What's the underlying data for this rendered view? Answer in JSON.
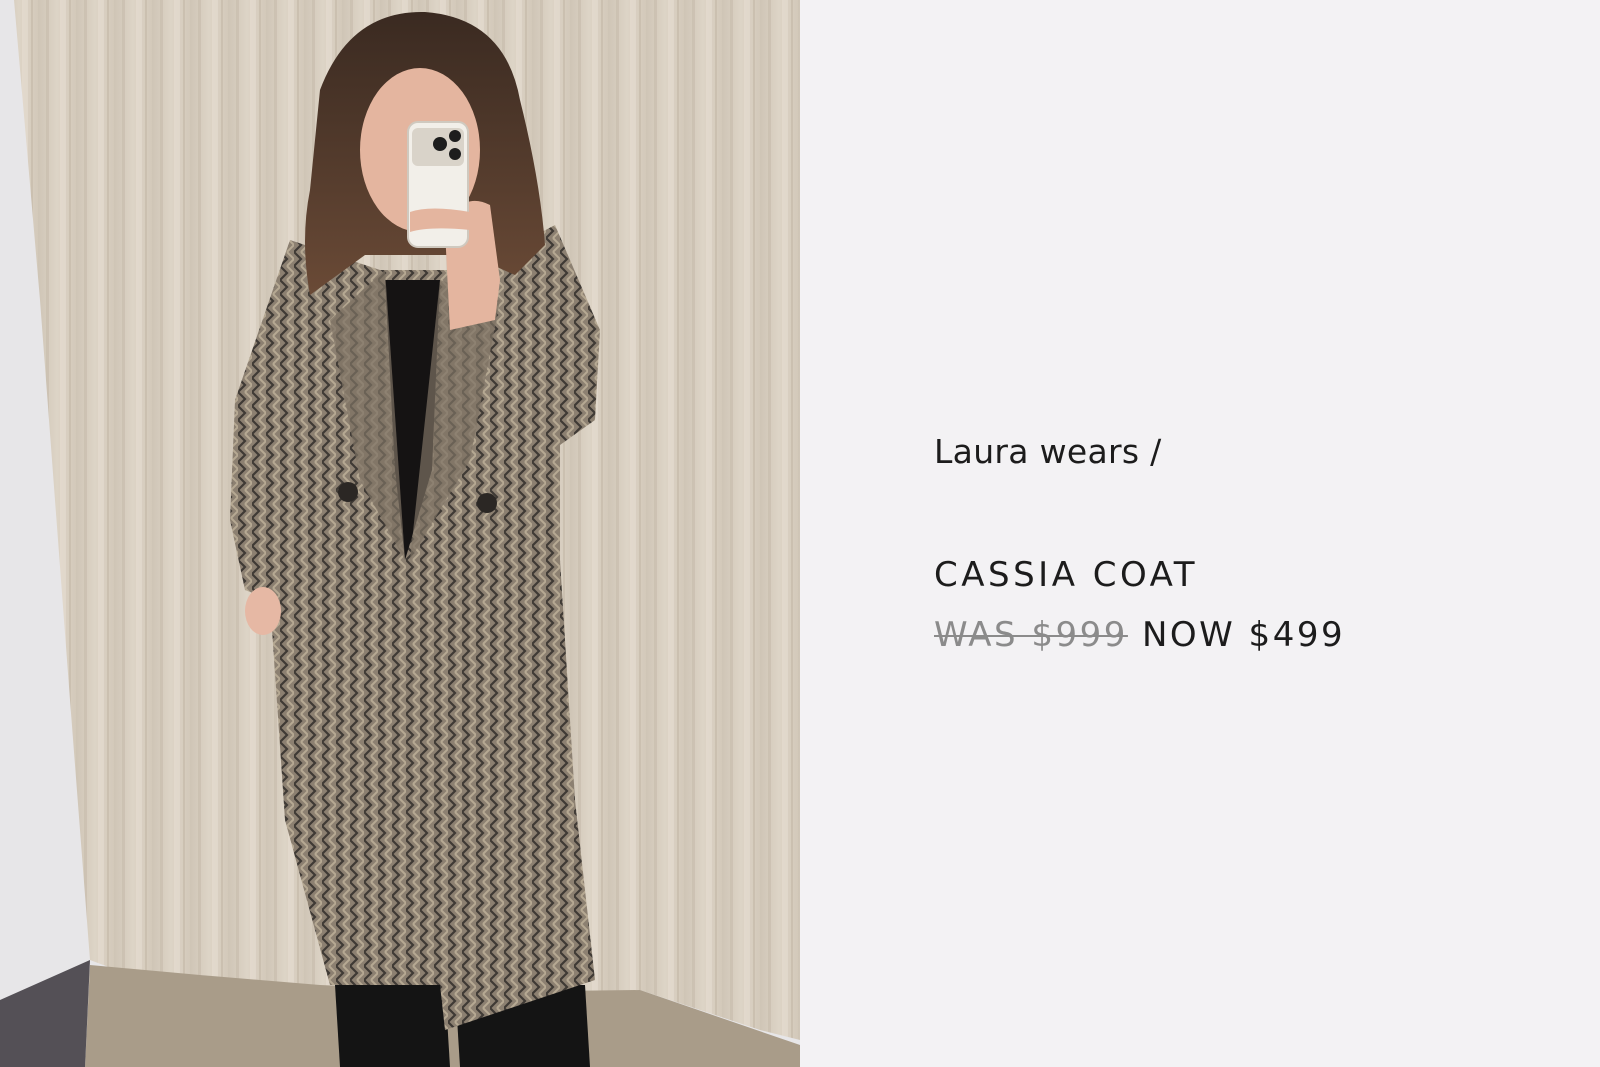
{
  "photo": {
    "alt": "Laura wearing the Cassia Coat in a fitting room mirror selfie"
  },
  "caption": {
    "lead": "Laura wears /"
  },
  "product": {
    "name": "CASSIA COAT",
    "was_price": "WAS $999",
    "now_price": "NOW $499"
  },
  "colors": {
    "panel_background": "#f3f2f4",
    "text_primary": "#1c1c1c",
    "text_strikethrough": "#8b8b8b",
    "curtain": "#d6ccbd",
    "coat": "#6f6458"
  }
}
